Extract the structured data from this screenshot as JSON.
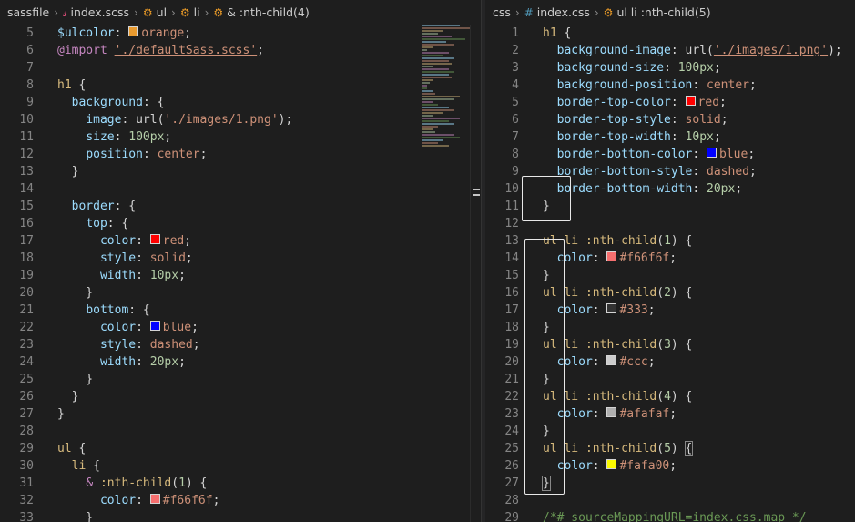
{
  "left": {
    "breadcrumbs": [
      {
        "label": "sassfile",
        "icon": ""
      },
      {
        "label": "index.scss",
        "icon": "sass-file-icon"
      },
      {
        "label": "ul",
        "icon": "symbol-class-icon"
      },
      {
        "label": "li",
        "icon": "symbol-class-icon"
      },
      {
        "label": "& :nth-child(4)",
        "icon": "symbol-class-icon"
      }
    ],
    "lines": [
      {
        "n": "5",
        "tokens": [
          [
            "var",
            "$ulcolor"
          ],
          [
            "pun",
            ": "
          ],
          [
            "sw",
            "#e89a2f"
          ],
          [
            "val",
            "orange"
          ],
          [
            "pun",
            ";"
          ]
        ]
      },
      {
        "n": "6",
        "tokens": [
          [
            "kw",
            "@import"
          ],
          [
            "pun",
            " "
          ],
          [
            "strurl",
            "'./defaultSass.scss'"
          ],
          [
            "pun",
            ";"
          ]
        ]
      },
      {
        "n": "7",
        "tokens": []
      },
      {
        "n": "8",
        "tokens": [
          [
            "sel",
            "h1"
          ],
          [
            "pun",
            " {"
          ]
        ]
      },
      {
        "n": "9",
        "tokens": [
          [
            "pun",
            "  "
          ],
          [
            "prop",
            "background"
          ],
          [
            "pun",
            ": {"
          ]
        ]
      },
      {
        "n": "10",
        "tokens": [
          [
            "pun",
            "    "
          ],
          [
            "prop",
            "image"
          ],
          [
            "pun",
            ": "
          ],
          [
            "fn",
            "url("
          ],
          [
            "str",
            "'./images/1.png'"
          ],
          [
            "fn",
            ")"
          ],
          [
            "pun",
            ";"
          ]
        ]
      },
      {
        "n": "11",
        "tokens": [
          [
            "pun",
            "    "
          ],
          [
            "prop",
            "size"
          ],
          [
            "pun",
            ": "
          ],
          [
            "num",
            "100px"
          ],
          [
            "pun",
            ";"
          ]
        ]
      },
      {
        "n": "12",
        "tokens": [
          [
            "pun",
            "    "
          ],
          [
            "prop",
            "position"
          ],
          [
            "pun",
            ": "
          ],
          [
            "val",
            "center"
          ],
          [
            "pun",
            ";"
          ]
        ]
      },
      {
        "n": "13",
        "tokens": [
          [
            "pun",
            "  }"
          ]
        ]
      },
      {
        "n": "14",
        "tokens": []
      },
      {
        "n": "15",
        "tokens": [
          [
            "pun",
            "  "
          ],
          [
            "prop",
            "border"
          ],
          [
            "pun",
            ": {"
          ]
        ]
      },
      {
        "n": "16",
        "tokens": [
          [
            "pun",
            "    "
          ],
          [
            "prop",
            "top"
          ],
          [
            "pun",
            ": {"
          ]
        ]
      },
      {
        "n": "17",
        "tokens": [
          [
            "pun",
            "      "
          ],
          [
            "prop",
            "color"
          ],
          [
            "pun",
            ": "
          ],
          [
            "sw",
            "#ff0000"
          ],
          [
            "val",
            "red"
          ],
          [
            "pun",
            ";"
          ]
        ]
      },
      {
        "n": "18",
        "tokens": [
          [
            "pun",
            "      "
          ],
          [
            "prop",
            "style"
          ],
          [
            "pun",
            ": "
          ],
          [
            "val",
            "solid"
          ],
          [
            "pun",
            ";"
          ]
        ]
      },
      {
        "n": "19",
        "tokens": [
          [
            "pun",
            "      "
          ],
          [
            "prop",
            "width"
          ],
          [
            "pun",
            ": "
          ],
          [
            "num",
            "10px"
          ],
          [
            "pun",
            ";"
          ]
        ]
      },
      {
        "n": "20",
        "tokens": [
          [
            "pun",
            "    }"
          ]
        ]
      },
      {
        "n": "21",
        "tokens": [
          [
            "pun",
            "    "
          ],
          [
            "prop",
            "bottom"
          ],
          [
            "pun",
            ": {"
          ]
        ]
      },
      {
        "n": "22",
        "tokens": [
          [
            "pun",
            "      "
          ],
          [
            "prop",
            "color"
          ],
          [
            "pun",
            ": "
          ],
          [
            "sw",
            "#0000ff"
          ],
          [
            "val",
            "blue"
          ],
          [
            "pun",
            ";"
          ]
        ]
      },
      {
        "n": "23",
        "tokens": [
          [
            "pun",
            "      "
          ],
          [
            "prop",
            "style"
          ],
          [
            "pun",
            ": "
          ],
          [
            "val",
            "dashed"
          ],
          [
            "pun",
            ";"
          ]
        ]
      },
      {
        "n": "24",
        "tokens": [
          [
            "pun",
            "      "
          ],
          [
            "prop",
            "width"
          ],
          [
            "pun",
            ": "
          ],
          [
            "num",
            "20px"
          ],
          [
            "pun",
            ";"
          ]
        ]
      },
      {
        "n": "25",
        "tokens": [
          [
            "pun",
            "    }"
          ]
        ]
      },
      {
        "n": "26",
        "tokens": [
          [
            "pun",
            "  }"
          ]
        ]
      },
      {
        "n": "27",
        "tokens": [
          [
            "pun",
            "}"
          ]
        ]
      },
      {
        "n": "28",
        "tokens": []
      },
      {
        "n": "29",
        "tokens": [
          [
            "sel",
            "ul"
          ],
          [
            "pun",
            " {"
          ]
        ]
      },
      {
        "n": "30",
        "tokens": [
          [
            "pun",
            "  "
          ],
          [
            "sel",
            "li"
          ],
          [
            "pun",
            " {"
          ]
        ]
      },
      {
        "n": "31",
        "tokens": [
          [
            "pun",
            "    "
          ],
          [
            "kw",
            "&"
          ],
          [
            "pun",
            " "
          ],
          [
            "sel",
            ":nth-child"
          ],
          [
            "pun",
            "("
          ],
          [
            "num",
            "1"
          ],
          [
            "pun",
            ") {"
          ]
        ]
      },
      {
        "n": "32",
        "tokens": [
          [
            "pun",
            "      "
          ],
          [
            "prop",
            "color"
          ],
          [
            "pun",
            ": "
          ],
          [
            "sw",
            "#f66f6f"
          ],
          [
            "val",
            "#f66f6f"
          ],
          [
            "pun",
            ";"
          ]
        ]
      },
      {
        "n": "33",
        "tokens": [
          [
            "pun",
            "    }"
          ]
        ]
      }
    ]
  },
  "right": {
    "breadcrumbs": [
      {
        "label": "css",
        "icon": ""
      },
      {
        "label": "index.css",
        "icon": "css-file-icon"
      },
      {
        "label": "ul li :nth-child(5)",
        "icon": "symbol-class-icon"
      }
    ],
    "lines": [
      {
        "n": "1",
        "tokens": [
          [
            "sel",
            "h1"
          ],
          [
            "pun",
            " {"
          ]
        ]
      },
      {
        "n": "2",
        "tokens": [
          [
            "pun",
            "  "
          ],
          [
            "prop",
            "background-image"
          ],
          [
            "pun",
            ": "
          ],
          [
            "fn",
            "url("
          ],
          [
            "strurl",
            "'./images/1.png'"
          ],
          [
            "fn",
            ")"
          ],
          [
            "pun",
            ";"
          ]
        ]
      },
      {
        "n": "3",
        "tokens": [
          [
            "pun",
            "  "
          ],
          [
            "prop",
            "background-size"
          ],
          [
            "pun",
            ": "
          ],
          [
            "num",
            "100px"
          ],
          [
            "pun",
            ";"
          ]
        ]
      },
      {
        "n": "4",
        "tokens": [
          [
            "pun",
            "  "
          ],
          [
            "prop",
            "background-position"
          ],
          [
            "pun",
            ": "
          ],
          [
            "val",
            "center"
          ],
          [
            "pun",
            ";"
          ]
        ]
      },
      {
        "n": "5",
        "tokens": [
          [
            "pun",
            "  "
          ],
          [
            "prop",
            "border-top-color"
          ],
          [
            "pun",
            ": "
          ],
          [
            "sw",
            "#ff0000"
          ],
          [
            "val",
            "red"
          ],
          [
            "pun",
            ";"
          ]
        ]
      },
      {
        "n": "6",
        "tokens": [
          [
            "pun",
            "  "
          ],
          [
            "prop",
            "border-top-style"
          ],
          [
            "pun",
            ": "
          ],
          [
            "val",
            "solid"
          ],
          [
            "pun",
            ";"
          ]
        ]
      },
      {
        "n": "7",
        "tokens": [
          [
            "pun",
            "  "
          ],
          [
            "prop",
            "border-top-width"
          ],
          [
            "pun",
            ": "
          ],
          [
            "num",
            "10px"
          ],
          [
            "pun",
            ";"
          ]
        ]
      },
      {
        "n": "8",
        "tokens": [
          [
            "pun",
            "  "
          ],
          [
            "prop",
            "border-bottom-color"
          ],
          [
            "pun",
            ": "
          ],
          [
            "sw",
            "#0000ff"
          ],
          [
            "val",
            "blue"
          ],
          [
            "pun",
            ";"
          ]
        ]
      },
      {
        "n": "9",
        "tokens": [
          [
            "pun",
            "  "
          ],
          [
            "prop",
            "border-bottom-style"
          ],
          [
            "pun",
            ": "
          ],
          [
            "val",
            "dashed"
          ],
          [
            "pun",
            ";"
          ]
        ]
      },
      {
        "n": "10",
        "tokens": [
          [
            "pun",
            "  "
          ],
          [
            "prop",
            "border-bottom-width"
          ],
          [
            "pun",
            ": "
          ],
          [
            "num",
            "20px"
          ],
          [
            "pun",
            ";"
          ]
        ]
      },
      {
        "n": "11",
        "tokens": [
          [
            "pun",
            "}"
          ]
        ]
      },
      {
        "n": "12",
        "tokens": []
      },
      {
        "n": "13",
        "tokens": [
          [
            "sel",
            "ul li :nth-child"
          ],
          [
            "pun",
            "("
          ],
          [
            "num",
            "1"
          ],
          [
            "pun",
            ") {"
          ]
        ]
      },
      {
        "n": "14",
        "tokens": [
          [
            "pun",
            "  "
          ],
          [
            "prop",
            "color"
          ],
          [
            "pun",
            ": "
          ],
          [
            "sw",
            "#f66f6f"
          ],
          [
            "val",
            "#f66f6f"
          ],
          [
            "pun",
            ";"
          ]
        ]
      },
      {
        "n": "15",
        "tokens": [
          [
            "pun",
            "}"
          ]
        ]
      },
      {
        "n": "16",
        "tokens": [
          [
            "sel",
            "ul li :nth-child"
          ],
          [
            "pun",
            "("
          ],
          [
            "num",
            "2"
          ],
          [
            "pun",
            ") {"
          ]
        ]
      },
      {
        "n": "17",
        "tokens": [
          [
            "pun",
            "  "
          ],
          [
            "prop",
            "color"
          ],
          [
            "pun",
            ": "
          ],
          [
            "sw",
            "#333333"
          ],
          [
            "val",
            "#333"
          ],
          [
            "pun",
            ";"
          ]
        ]
      },
      {
        "n": "18",
        "tokens": [
          [
            "pun",
            "}"
          ]
        ]
      },
      {
        "n": "19",
        "tokens": [
          [
            "sel",
            "ul li :nth-child"
          ],
          [
            "pun",
            "("
          ],
          [
            "num",
            "3"
          ],
          [
            "pun",
            ") {"
          ]
        ]
      },
      {
        "n": "20",
        "tokens": [
          [
            "pun",
            "  "
          ],
          [
            "prop",
            "color"
          ],
          [
            "pun",
            ": "
          ],
          [
            "sw",
            "#cccccc"
          ],
          [
            "val",
            "#ccc"
          ],
          [
            "pun",
            ";"
          ]
        ]
      },
      {
        "n": "21",
        "tokens": [
          [
            "pun",
            "}"
          ]
        ]
      },
      {
        "n": "22",
        "tokens": [
          [
            "sel",
            "ul li :nth-child"
          ],
          [
            "pun",
            "("
          ],
          [
            "num",
            "4"
          ],
          [
            "pun",
            ") {"
          ]
        ]
      },
      {
        "n": "23",
        "tokens": [
          [
            "pun",
            "  "
          ],
          [
            "prop",
            "color"
          ],
          [
            "pun",
            ": "
          ],
          [
            "sw",
            "#afafaf"
          ],
          [
            "val",
            "#afafaf"
          ],
          [
            "pun",
            ";"
          ]
        ]
      },
      {
        "n": "24",
        "tokens": [
          [
            "pun",
            "}"
          ]
        ]
      },
      {
        "n": "25",
        "tokens": [
          [
            "sel",
            "ul li :nth-child"
          ],
          [
            "pun",
            "("
          ],
          [
            "num",
            "5"
          ],
          [
            "pun",
            ") "
          ],
          [
            "brk",
            "{"
          ]
        ]
      },
      {
        "n": "26",
        "tokens": [
          [
            "pun",
            "  "
          ],
          [
            "prop",
            "color"
          ],
          [
            "pun",
            ": "
          ],
          [
            "sw",
            "#fafa00"
          ],
          [
            "val",
            "#fafa00"
          ],
          [
            "pun",
            ";"
          ]
        ]
      },
      {
        "n": "27",
        "tokens": [
          [
            "brk",
            "}"
          ]
        ]
      },
      {
        "n": "28",
        "tokens": []
      },
      {
        "n": "29",
        "tokens": [
          [
            "com",
            "/*# sourceMappingURL=index.css.map */"
          ]
        ]
      }
    ]
  }
}
